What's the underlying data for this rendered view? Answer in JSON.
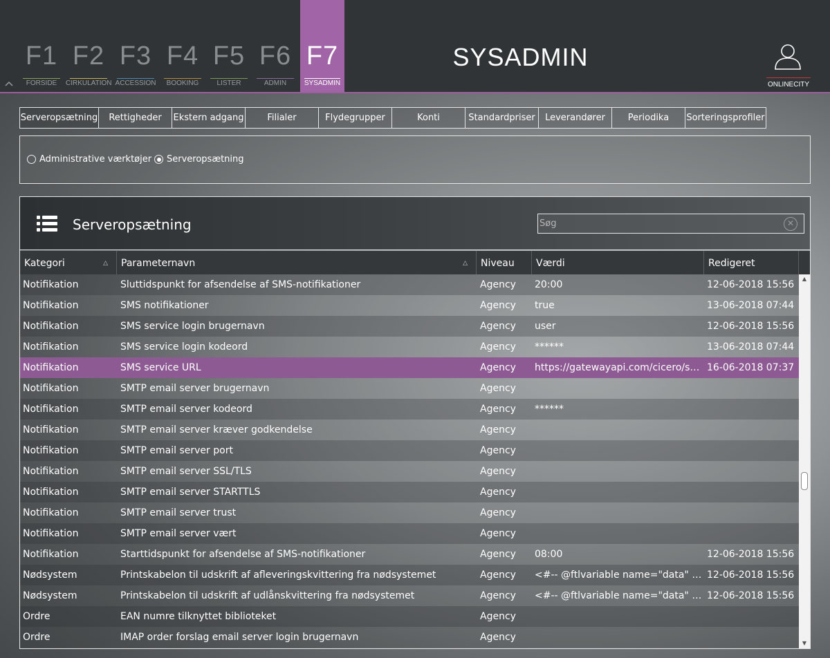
{
  "fkeys": [
    {
      "key": "F1",
      "label": "FORSIDE",
      "color": "#8aa05a"
    },
    {
      "key": "F2",
      "label": "CIRKULATION",
      "color": "#c8b44a"
    },
    {
      "key": "F3",
      "label": "ACCESSION",
      "color": "#4a8ab0"
    },
    {
      "key": "F4",
      "label": "BOOKING",
      "color": "#b88a3a"
    },
    {
      "key": "F5",
      "label": "LISTER",
      "color": "#7a9a5a"
    },
    {
      "key": "F6",
      "label": "ADMIN",
      "color": "#8a6aa0"
    },
    {
      "key": "F7",
      "label": "SYSADMIN",
      "color": "#ffffff"
    }
  ],
  "app_title": "SYSADMIN",
  "user": {
    "label": "ONLINECITY"
  },
  "tabs": [
    "Serveropsætning",
    "Rettigheder",
    "Ekstern adgang",
    "Filialer",
    "Flydegrupper",
    "Konti",
    "Standardpriser",
    "Leverandører",
    "Periodika",
    "Sorteringsprofiler"
  ],
  "radios": {
    "option1": "Administrative værktøjer",
    "option2": "Serveropsætning"
  },
  "panel": {
    "title": "Serveropsætning",
    "search_placeholder": "Søg"
  },
  "table": {
    "columns": [
      "Kategori",
      "Parameternavn",
      "Niveau",
      "Værdi",
      "Redigeret"
    ],
    "rows": [
      [
        "Notifikation",
        "Sluttidspunkt for afsendelse af SMS-notifikationer",
        "Agency",
        "20:00",
        "12-06-2018 15:56"
      ],
      [
        "Notifikation",
        "SMS notifikationer",
        "Agency",
        "true",
        "13-06-2018 07:44"
      ],
      [
        "Notifikation",
        "SMS service login brugernavn",
        "Agency",
        "user",
        "12-06-2018 15:56"
      ],
      [
        "Notifikation",
        "SMS service login kodeord",
        "Agency",
        "******",
        "13-06-2018 07:44"
      ],
      [
        "Notifikation",
        "SMS service URL",
        "Agency",
        "https://gatewayapi.com/cicero/sen…",
        "16-06-2018 07:37"
      ],
      [
        "Notifikation",
        "SMTP email server brugernavn",
        "Agency",
        "",
        ""
      ],
      [
        "Notifikation",
        "SMTP email server kodeord",
        "Agency",
        "******",
        ""
      ],
      [
        "Notifikation",
        "SMTP email server kræver godkendelse",
        "Agency",
        "",
        ""
      ],
      [
        "Notifikation",
        "SMTP email server port",
        "Agency",
        "",
        ""
      ],
      [
        "Notifikation",
        "SMTP email server SSL/TLS",
        "Agency",
        "",
        ""
      ],
      [
        "Notifikation",
        "SMTP email server STARTTLS",
        "Agency",
        "",
        ""
      ],
      [
        "Notifikation",
        "SMTP email server trust",
        "Agency",
        "",
        ""
      ],
      [
        "Notifikation",
        "SMTP email server vært",
        "Agency",
        "",
        ""
      ],
      [
        "Notifikation",
        "Starttidspunkt for afsendelse af SMS-notifikationer",
        "Agency",
        "08:00",
        "12-06-2018 15:56"
      ],
      [
        "Nødsystem",
        "Printskabelon til udskrift af afleveringskvittering fra nødsystemet",
        "Agency",
        "<#-- @ftlvariable name=\"data\" ty…",
        "12-06-2018 15:56"
      ],
      [
        "Nødsystem",
        "Printskabelon til udskrift af udlånskvittering fra nødsystemet",
        "Agency",
        "<#-- @ftlvariable name=\"data\" ty…",
        "12-06-2018 15:56"
      ],
      [
        "Ordre",
        "EAN numre tilknyttet biblioteket",
        "Agency",
        "",
        ""
      ],
      [
        "Ordre",
        "IMAP order forslag email server login brugernavn",
        "Agency",
        "",
        ""
      ]
    ],
    "selected_row": 4
  },
  "colors": {
    "accent": "#a064a7",
    "selected_row": "#8e5a93",
    "topbar": "#303436"
  }
}
